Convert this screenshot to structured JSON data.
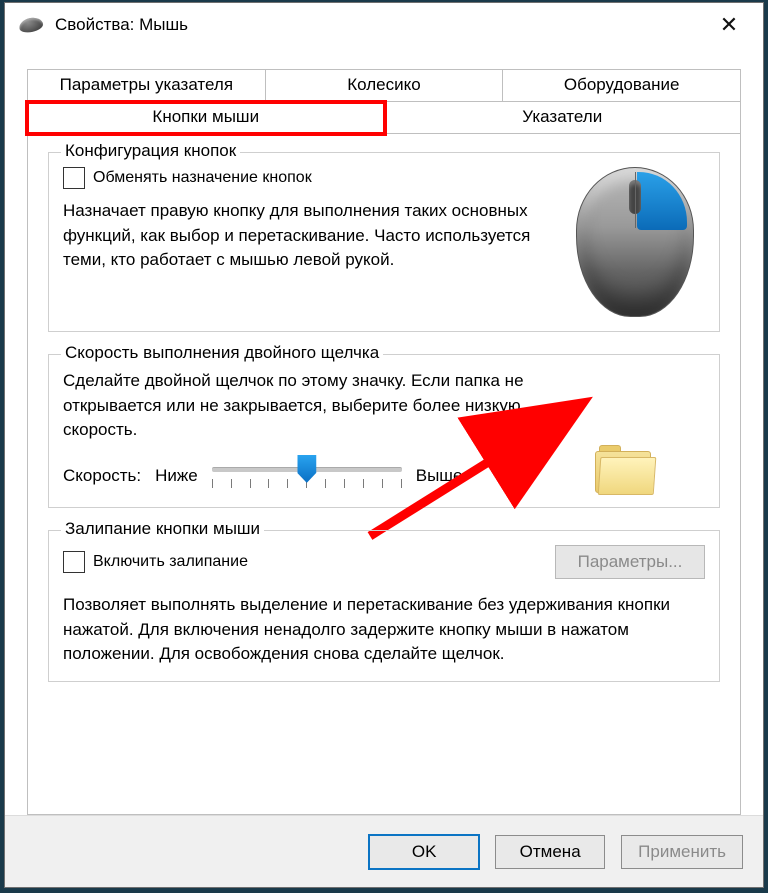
{
  "window": {
    "title": "Свойства: Мышь"
  },
  "tabs": {
    "topRow": [
      "Параметры указателя",
      "Колесико",
      "Оборудование"
    ],
    "bottomRow": [
      "Кнопки мыши",
      "Указатели"
    ],
    "active": "Кнопки мыши"
  },
  "group_buttons": {
    "title": "Конфигурация кнопок",
    "swap_label": "Обменять назначение кнопок",
    "swap_checked": false,
    "desc": "Назначает правую кнопку для выполнения таких основных функций, как выбор и перетаскивание. Часто используется теми, кто работает с мышью левой рукой."
  },
  "group_speed": {
    "title": "Скорость выполнения двойного щелчка",
    "desc": "Сделайте двойной щелчок по этому значку. Если папка не открывается или не закрывается, выберите более низкую скорость.",
    "speed_label": "Скорость:",
    "slow": "Ниже",
    "fast": "Выше"
  },
  "group_sticky": {
    "title": "Залипание кнопки мыши",
    "enable_label": "Включить залипание",
    "enable_checked": false,
    "params_btn": "Параметры...",
    "desc": "Позволяет выполнять выделение и перетаскивание без удерживания кнопки нажатой. Для включения ненадолго задержите кнопку мыши в нажатом положении. Для освобождения снова сделайте щелчок."
  },
  "footer": {
    "ok": "OK",
    "cancel": "Отмена",
    "apply": "Применить"
  }
}
